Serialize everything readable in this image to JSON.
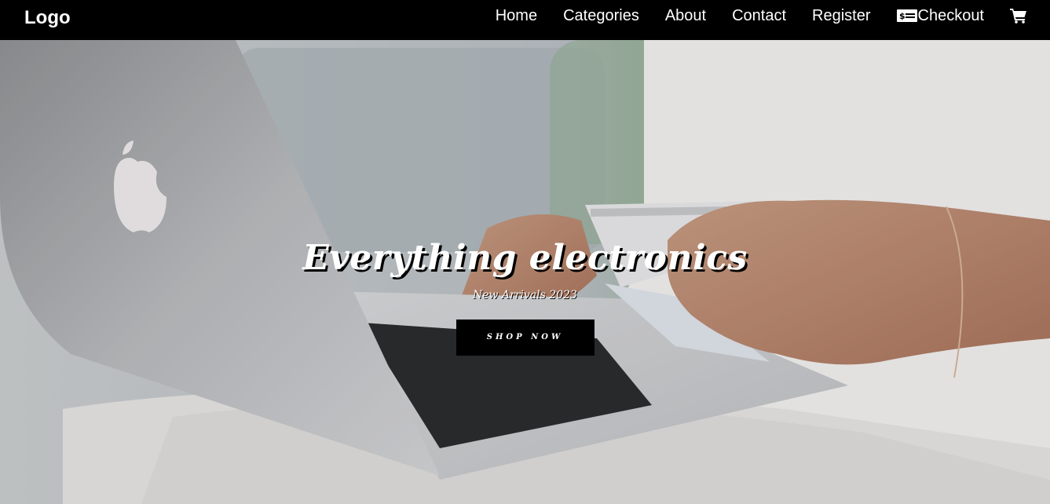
{
  "nav": {
    "logo": "Logo",
    "links": [
      {
        "label": "Home"
      },
      {
        "label": "Categories"
      },
      {
        "label": "About"
      },
      {
        "label": "Contact"
      },
      {
        "label": "Register"
      },
      {
        "label": "Checkout",
        "icon": "cash-register-icon"
      }
    ],
    "cart_icon": "shopping-cart-icon"
  },
  "hero": {
    "title": "Everything electronics",
    "subtitle": "New Arrivals 2023",
    "button_label": "SHOP NOW",
    "image": "photo of a person holding a credit card over a laptop"
  },
  "colors": {
    "nav_bg": "#000000",
    "nav_text": "#ffffff",
    "button_bg": "#000000",
    "button_text": "#ffffff"
  }
}
